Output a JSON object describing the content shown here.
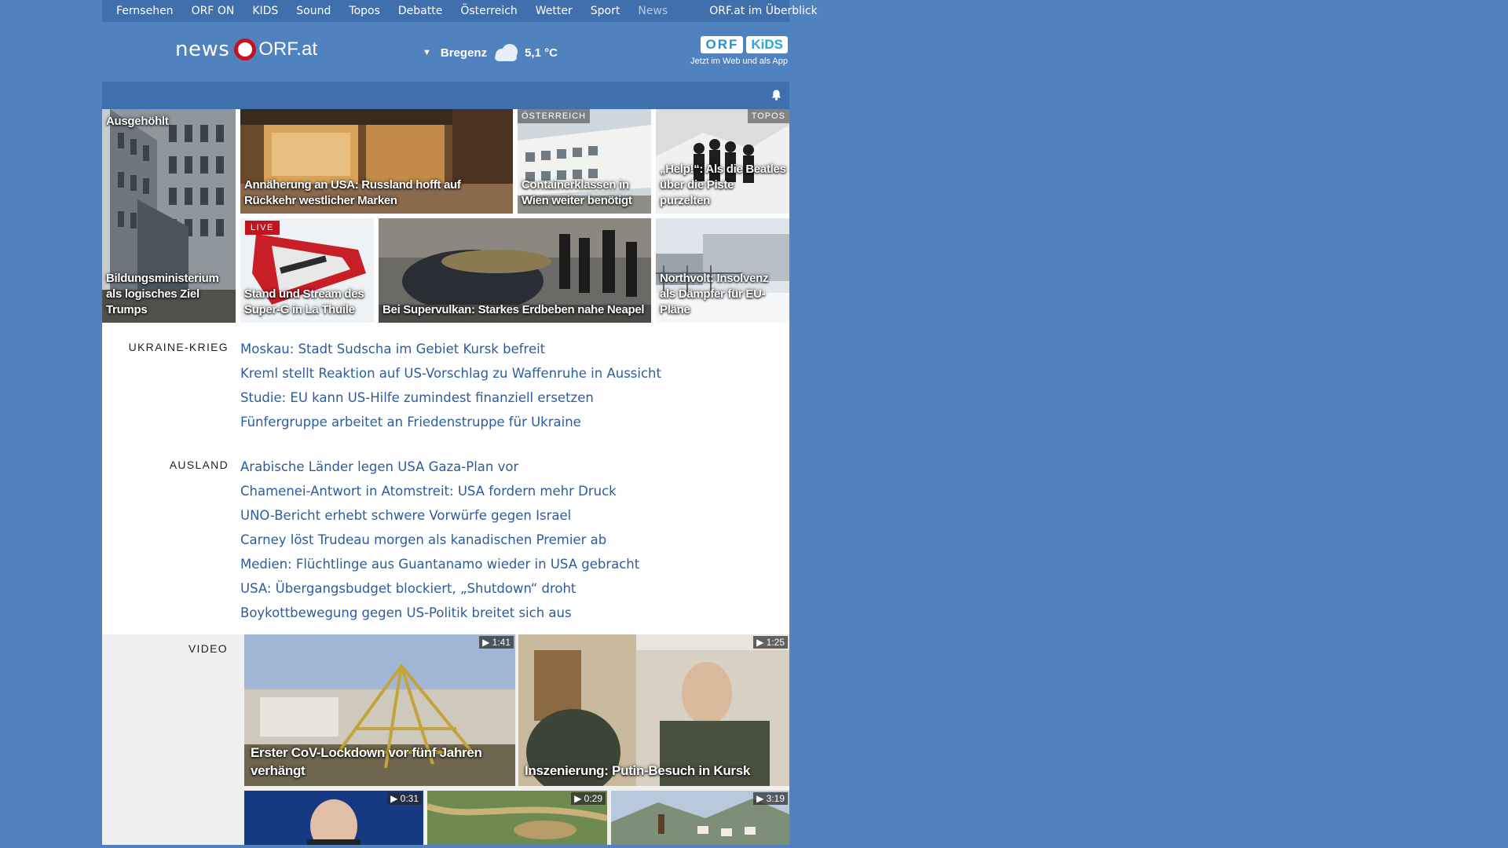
{
  "topnav": {
    "items": [
      "Fernsehen",
      "ORF ON",
      "KIDS",
      "Sound",
      "Topos",
      "Debatte",
      "Österreich",
      "Wetter",
      "Sport",
      "News"
    ],
    "active": "News",
    "overview": "ORF.at im Überblick"
  },
  "header": {
    "logo_news": "news",
    "logo_orf": "ORF.at",
    "weather_location": "Bregenz",
    "weather_temp": "5,1 °C",
    "kids_badge_1": "ORF",
    "kids_badge_2": "KiDS",
    "kids_tagline": "Jetzt im Web und als App"
  },
  "tiles": [
    {
      "caption_top": "Ausgehöhlt",
      "caption": "Bildungsministerium als logisches Ziel Trumps"
    },
    {
      "caption": "Annäherung an USA: Russland hofft auf Rückkehr westlicher Marken"
    },
    {
      "kicker": "ÖSTERREICH",
      "caption": "Containerklassen in Wien weiter benötigt"
    },
    {
      "kicker": "TOPOS",
      "caption": "„Help!“: Als die Beatles über die Piste purzelten"
    },
    {
      "live": "LIVE",
      "caption": "Stand und Stream des Super-G in La Thuile"
    },
    {
      "caption": "Bei Supervulkan: Starkes Erdbeben nahe Neapel"
    },
    {
      "caption": "Northvolt: Insolvenz als Dämpfer für EU-Pläne"
    }
  ],
  "sections": [
    {
      "label": "UKRAINE-KRIEG",
      "items": [
        "Moskau: Stadt Sudscha im Gebiet Kursk befreit",
        "Kreml stellt Reaktion auf US-Vorschlag zu Waffenruhe in Aussicht",
        "Studie: EU kann US-Hilfe zumindest finanziell ersetzen",
        "Fünfergruppe arbeitet an Friedenstruppe für Ukraine"
      ]
    },
    {
      "label": "AUSLAND",
      "items": [
        "Arabische Länder legen USA Gaza-Plan vor",
        "Chamenei-Antwort in Atomstreit: USA fordern mehr Druck",
        "UNO-Bericht erhebt schwere Vorwürfe gegen Israel",
        "Carney löst Trudeau morgen als kanadischen Premier ab",
        "Medien: Flüchtlinge aus Guantanamo wieder in USA gebracht",
        "USA: Übergangsbudget blockiert, „Shutdown“ droht",
        "Boykottbewegung gegen US-Politik breitet sich aus"
      ]
    }
  ],
  "video": {
    "label": "VIDEO",
    "items": [
      {
        "duration": "1:41",
        "caption": "Erster CoV-Lockdown vor fünf Jahren verhängt"
      },
      {
        "duration": "1:25",
        "caption": "Inszenierung: Putin-Besuch in Kursk"
      },
      {
        "duration": "0:31",
        "caption": ""
      },
      {
        "duration": "0:29",
        "caption": ""
      },
      {
        "duration": "3:19",
        "caption": ""
      }
    ]
  }
}
